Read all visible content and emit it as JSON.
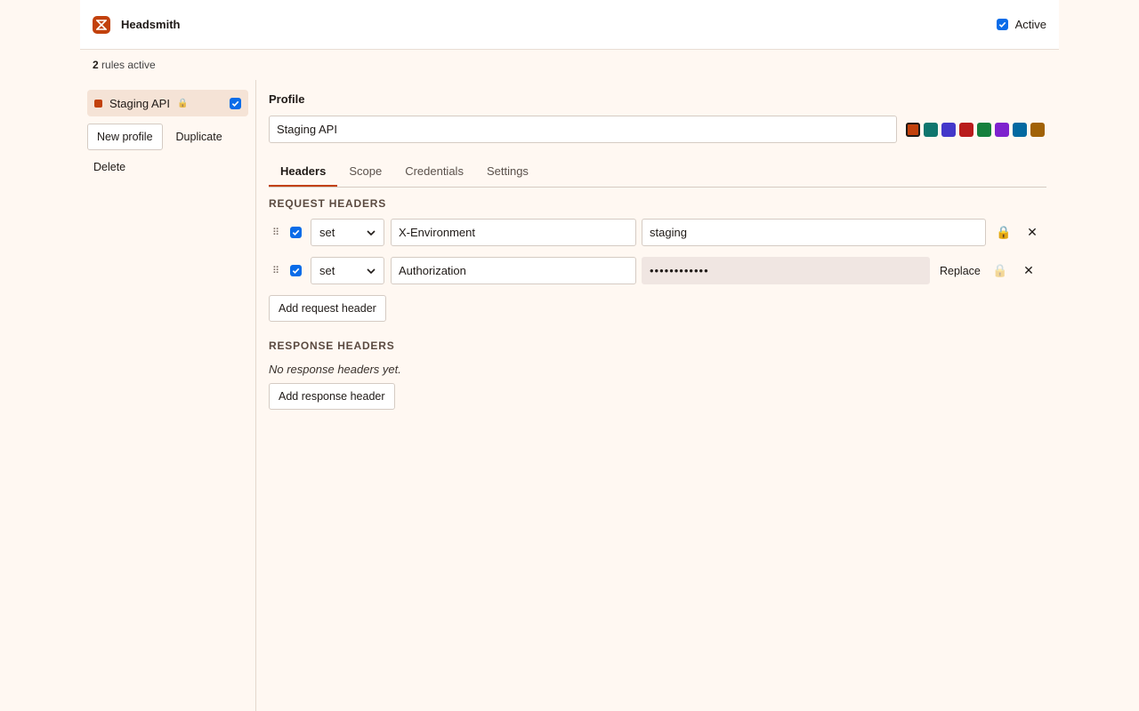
{
  "app": {
    "title": "Headsmith",
    "active_label": "Active",
    "brand_color": "#c2410c"
  },
  "status": {
    "count": "2",
    "suffix": "rules active"
  },
  "sidebar": {
    "profiles": [
      {
        "name": "Staging API",
        "color": "#c2410c",
        "locked": true,
        "enabled": true
      }
    ],
    "actions": {
      "new_profile": "New profile",
      "duplicate": "Duplicate",
      "delete": "Delete"
    }
  },
  "profile": {
    "label": "Profile",
    "name": "Staging API",
    "colors": [
      "#c2410c",
      "#0f766e",
      "#4338ca",
      "#b91c1c",
      "#15803d",
      "#7e22ce",
      "#0369a1",
      "#a16207"
    ],
    "selected_color": "#c2410c"
  },
  "tabs": [
    {
      "label": "Headers",
      "active": true
    },
    {
      "label": "Scope",
      "active": false
    },
    {
      "label": "Credentials",
      "active": false
    },
    {
      "label": "Settings",
      "active": false
    }
  ],
  "request_headers": {
    "title": "REQUEST HEADERS",
    "rows": [
      {
        "op": "set",
        "name": "X-Environment",
        "value": "staging",
        "enabled": true,
        "locked": true,
        "secret": false
      },
      {
        "op": "set",
        "name": "Authorization",
        "value": "••••••••••••",
        "enabled": true,
        "locked": false,
        "secret": true,
        "replace_label": "Replace"
      }
    ],
    "add_label": "Add request header"
  },
  "response_headers": {
    "title": "RESPONSE HEADERS",
    "empty": "No response headers yet.",
    "add_label": "Add response header"
  }
}
